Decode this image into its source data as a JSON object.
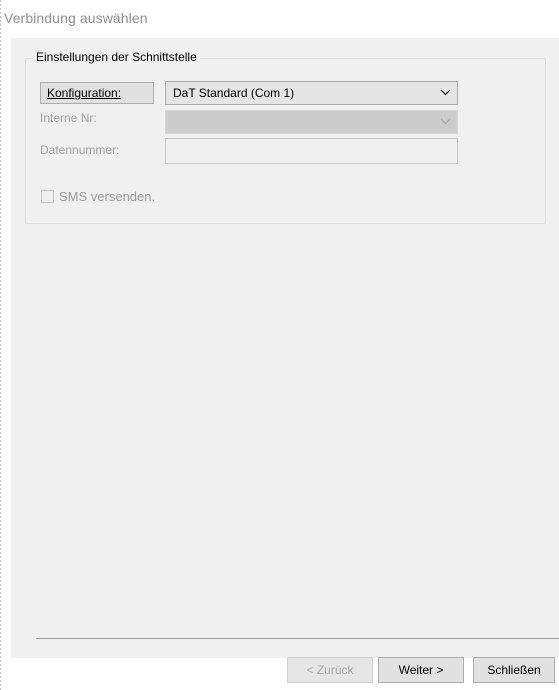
{
  "window": {
    "title": "Verbindung auswählen"
  },
  "group": {
    "title": "Einstellungen der Schnittstelle"
  },
  "konfiguration": {
    "label": "Konfiguration:",
    "selected": "DaT Standard (Com 1)"
  },
  "interne_nr": {
    "label": "Interne Nr:",
    "selected": ""
  },
  "datennummer": {
    "label": "Datennummer:",
    "value": ""
  },
  "sms": {
    "label": "SMS versenden.",
    "checked": false
  },
  "buttons": {
    "back": "< Zurück",
    "next": "Weiter >",
    "close": "Schließen"
  },
  "icons": {
    "dropdown": "chevron-down-icon",
    "dropdown_disabled": "chevron-down-icon"
  }
}
